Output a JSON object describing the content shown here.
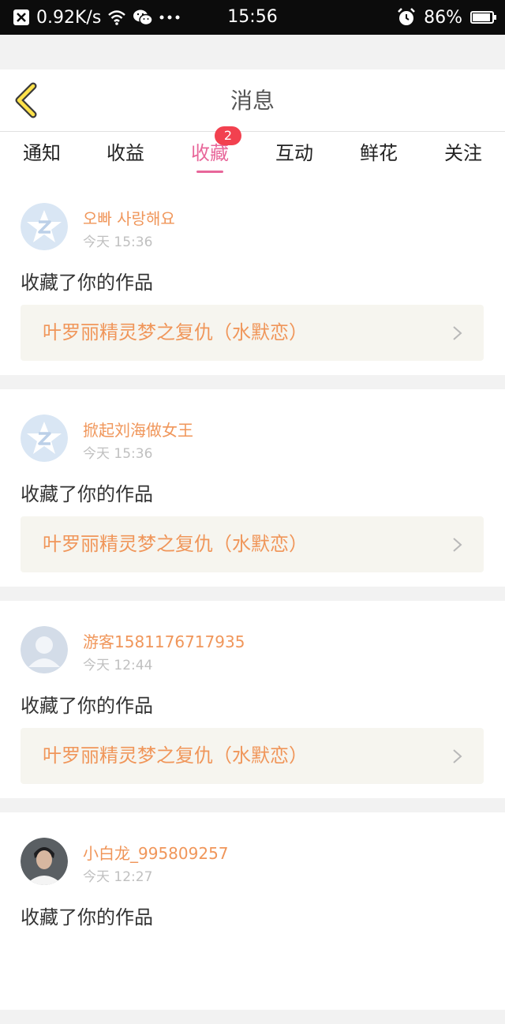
{
  "status_bar": {
    "speed": "0.92K/s",
    "time": "15:56",
    "battery": "86%",
    "battery_level": 0.86
  },
  "header": {
    "title": "消息"
  },
  "tabs": [
    {
      "label": "通知"
    },
    {
      "label": "收益"
    },
    {
      "label": "收藏",
      "active": true,
      "badge": "2"
    },
    {
      "label": "互动"
    },
    {
      "label": "鲜花"
    },
    {
      "label": "关注"
    }
  ],
  "colors": {
    "accent": "#e8679a",
    "name": "#f0965a",
    "badge": "#f2414f"
  },
  "items": [
    {
      "user": "오빠 사랑해요",
      "time": "今天 15:36",
      "action": "收藏了你的作品",
      "work": "叶罗丽精灵梦之复仇（水默恋）",
      "avatar": "qq-default-icon"
    },
    {
      "user": "掀起刘海做女王",
      "time": "今天 15:36",
      "action": "收藏了你的作品",
      "work": "叶罗丽精灵梦之复仇（水默恋）",
      "avatar": "qq-default-icon"
    },
    {
      "user": "游客1581176717935",
      "time": "今天 12:44",
      "action": "收藏了你的作品",
      "work": "叶罗丽精灵梦之复仇（水默恋）",
      "avatar": "guest-silhouette-icon"
    },
    {
      "user": "小白龙_995809257",
      "time": "今天 12:27",
      "action": "收藏了你的作品",
      "work": "",
      "avatar": "user-photo"
    }
  ]
}
